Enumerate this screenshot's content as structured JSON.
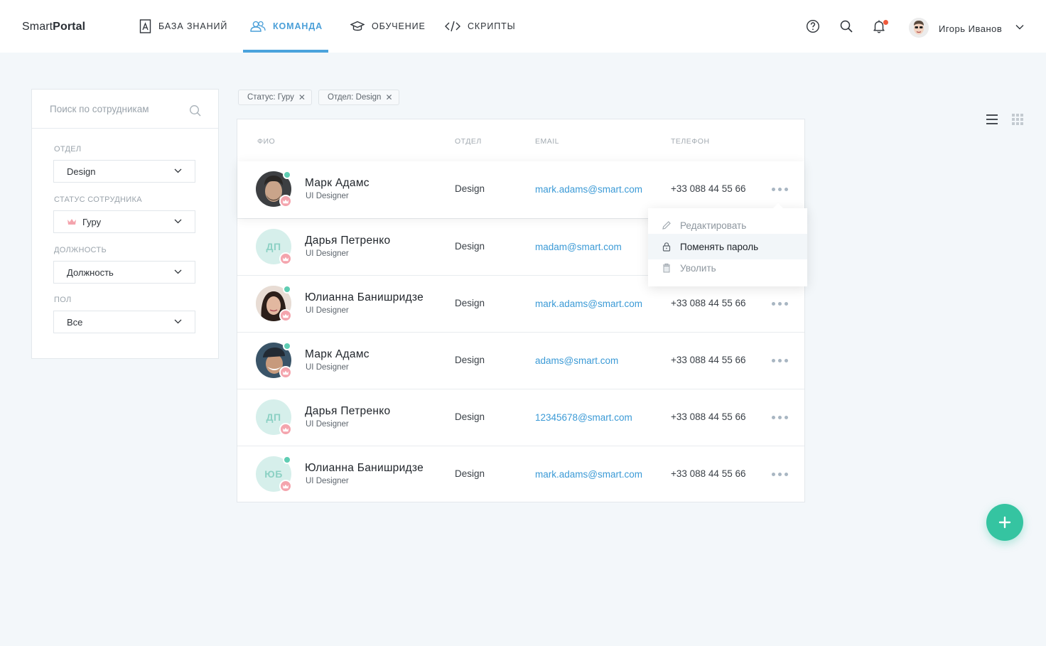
{
  "app": {
    "logo_regular": "Smart",
    "logo_bold": "Portal"
  },
  "nav": [
    {
      "label": "База знаний",
      "icon": "book-icon"
    },
    {
      "label": "Команда",
      "icon": "users-icon",
      "active": true
    },
    {
      "label": "Обучение",
      "icon": "graduation-cap-icon"
    },
    {
      "label": "Скрипты",
      "icon": "code-icon"
    }
  ],
  "header": {
    "icons": [
      "help-icon",
      "search-icon",
      "bell-icon"
    ],
    "has_notification": true,
    "user_name": "Игорь Иванов"
  },
  "sidebar": {
    "search_placeholder": "Поиск по сотрудникам",
    "filters": [
      {
        "label": "Отдел",
        "value": "Design"
      },
      {
        "label": "Статус сотрудника",
        "value": "Гуру",
        "icon": "crown-icon"
      },
      {
        "label": "Должность",
        "value": "Должность"
      },
      {
        "label": "Пол",
        "value": "Все"
      }
    ]
  },
  "chips": [
    {
      "label": "Статус: Гуру"
    },
    {
      "label": "Отдел: Design"
    }
  ],
  "table": {
    "columns": [
      "ФИО",
      "Отдел",
      "Email",
      "Телефон"
    ],
    "rows": [
      {
        "name": "Марк Адамс",
        "role": "UI Designer",
        "dept": "Design",
        "email": "mark.adams@smart.com",
        "phone": "+33 088 44 55 66",
        "initials": "",
        "online": true
      },
      {
        "name": "Дарья Петренко",
        "role": "UI Designer",
        "dept": "Design",
        "email": "madam@smart.com",
        "phone": "",
        "initials": "ДП",
        "online": false
      },
      {
        "name": "Юлианна Банишридзе",
        "role": "UI Designer",
        "dept": "Design",
        "email": "mark.adams@smart.com",
        "phone": "+33 088 44 55 66",
        "initials": "",
        "online": true
      },
      {
        "name": "Марк Адамс",
        "role": "UI Designer",
        "dept": "Design",
        "email": "adams@smart.com",
        "phone": "+33 088 44 55 66",
        "initials": "",
        "online": true
      },
      {
        "name": "Дарья Петренко",
        "role": "UI Designer",
        "dept": "Design",
        "email": "12345678@smart.com",
        "phone": "+33 088 44 55 66",
        "initials": "ДП",
        "online": false
      },
      {
        "name": "Юлианна Банишридзе",
        "role": "UI Designer",
        "dept": "Design",
        "email": "mark.adams@smart.com",
        "phone": "+33 088 44 55 66",
        "initials": "ЮБ",
        "online": true
      }
    ]
  },
  "row_menu": {
    "items": [
      {
        "label": "Редактировать",
        "icon": "pencil-icon"
      },
      {
        "label": "Поменять пароль",
        "icon": "lock-icon",
        "active": true
      },
      {
        "label": "Уволить",
        "icon": "trash-icon"
      }
    ]
  },
  "view_toggle": [
    "list-view-icon",
    "grid-view-icon"
  ],
  "fab": {
    "icon": "plus-icon"
  },
  "colors": {
    "accent": "#4aa3dc",
    "teal": "#35c4a1",
    "online": "#5fcdb3",
    "crown": "#f4a4ad",
    "link": "#3b9ad6"
  }
}
